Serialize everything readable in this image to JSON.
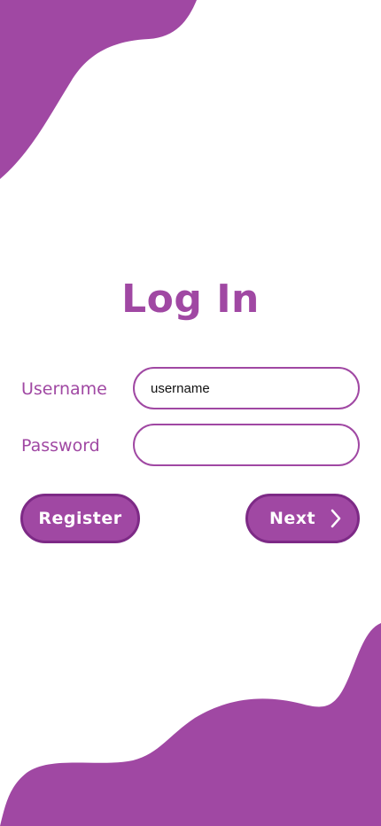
{
  "colors": {
    "accent": "#a048a3",
    "button_border": "#7d2a86",
    "background": "#ffffff"
  },
  "login": {
    "title": "Log In",
    "username_label": "Username",
    "username_value": "username",
    "password_label": "Password",
    "password_value": "",
    "register_label": "Register",
    "next_label": "Next",
    "next_icon": "chevron-right-icon"
  }
}
